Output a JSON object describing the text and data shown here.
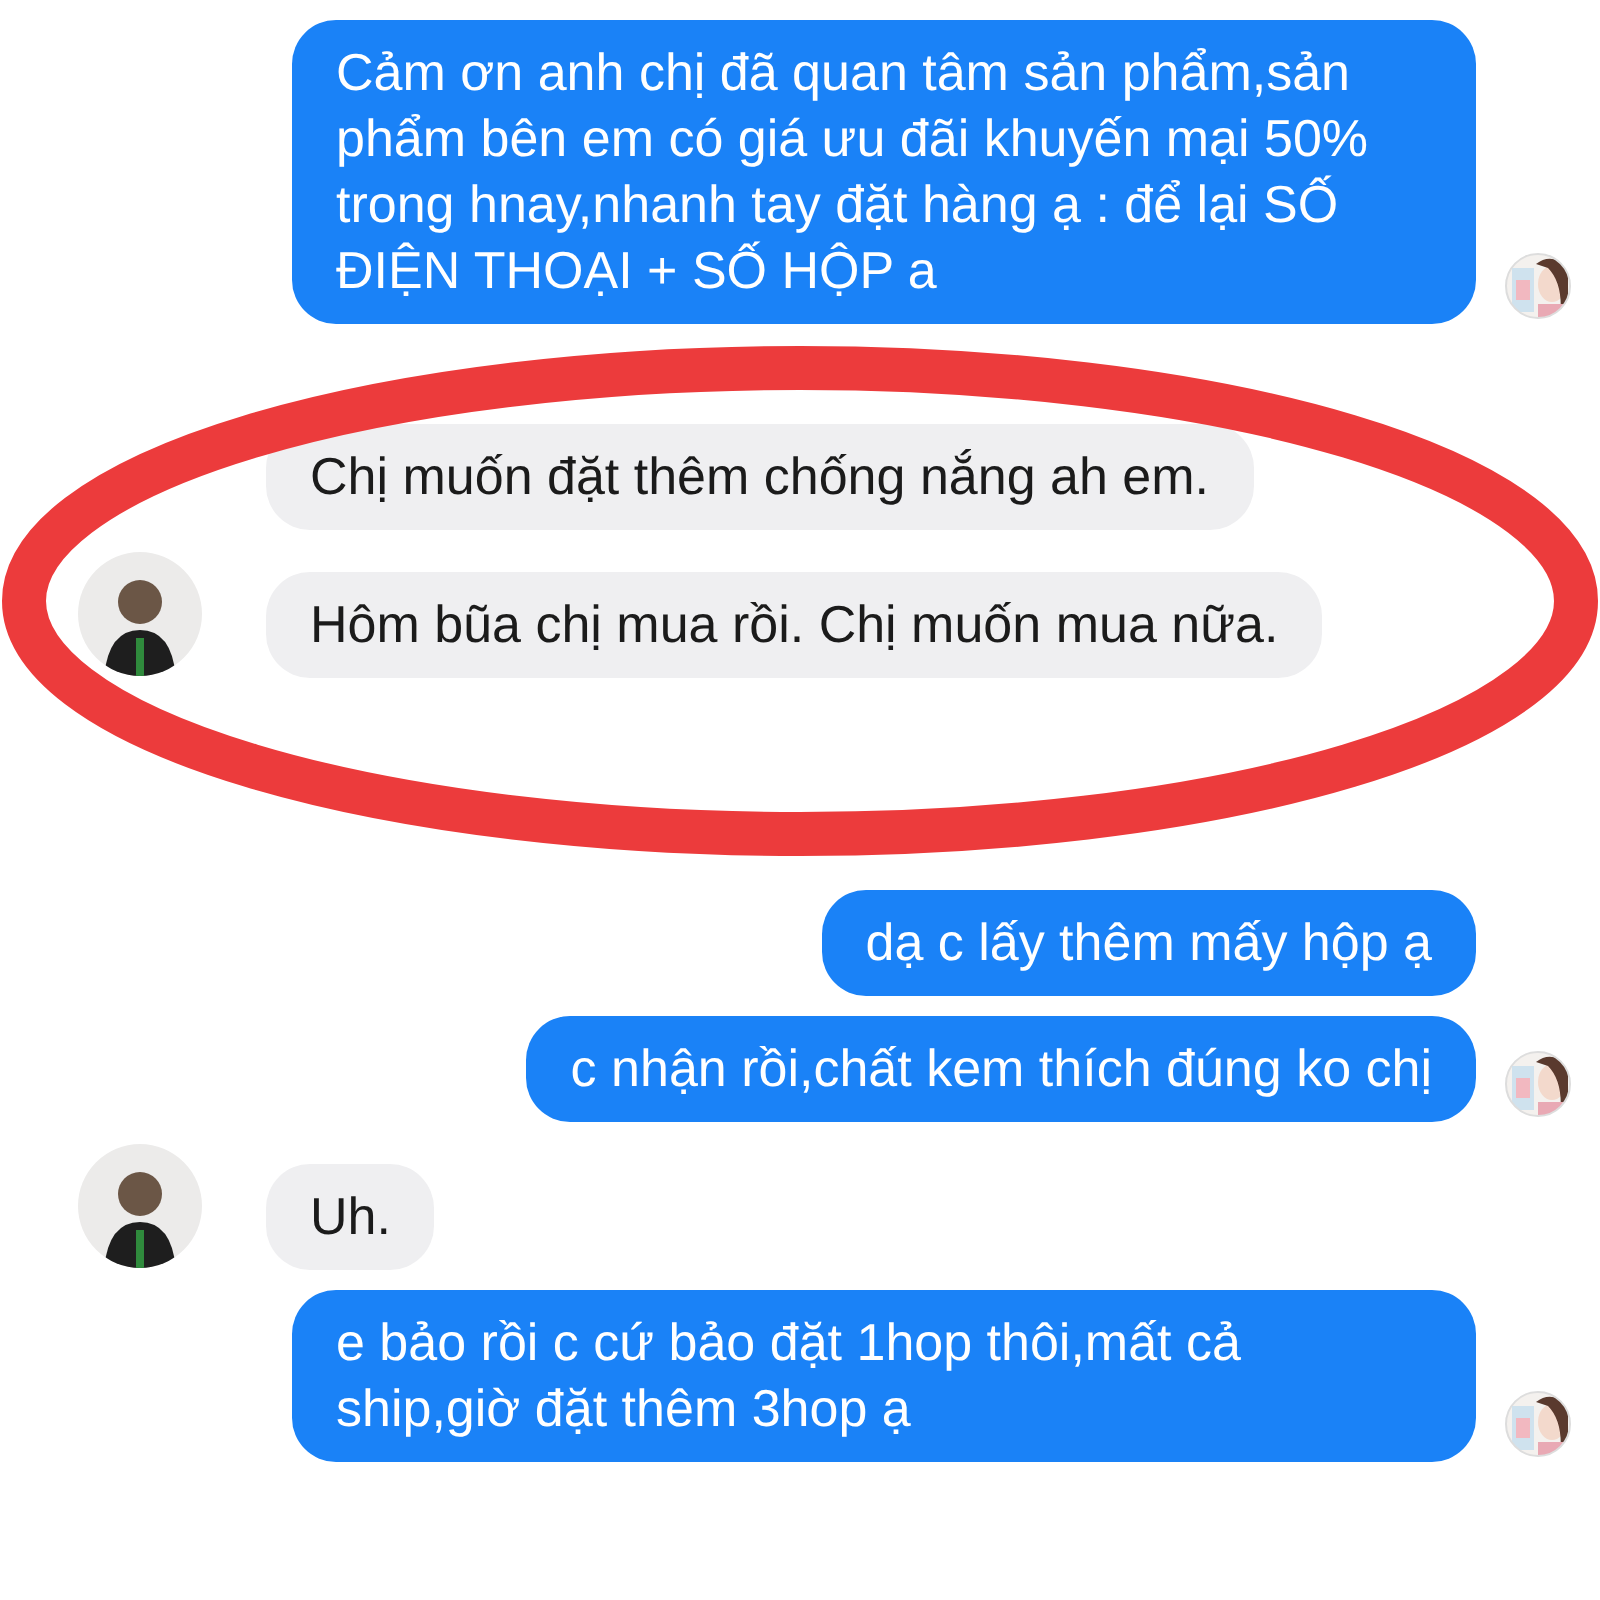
{
  "messages": [
    {
      "kind": "outgoing",
      "text": "Cảm ơn anh chị đã quan tâm sản phẩm,sản phẩm  bên em có giá ưu đãi khuyến mại 50% trong hnay,nhanh tay đặt hàng ạ : để lại SỐ ĐIỆN THOẠI + SỐ HỘP a",
      "avatar": true,
      "circled": false
    },
    {
      "kind": "incoming",
      "text": "Chị muốn đặt thêm chống nắng ah em.",
      "avatar": false,
      "circled": true
    },
    {
      "kind": "incoming",
      "text": "Hôm bũa chị mua rồi. Chị muốn mua nữa.",
      "avatar": true,
      "circled": true
    },
    {
      "kind": "outgoing",
      "text": "dạ c lấy thêm mấy hộp ạ",
      "avatar": false,
      "circled": false
    },
    {
      "kind": "outgoing",
      "text": "c nhận rồi,chất kem thích đúng ko chị",
      "avatar": true,
      "circled": false
    },
    {
      "kind": "incoming",
      "text": "Uh.",
      "avatar": true,
      "circled": false
    },
    {
      "kind": "outgoing",
      "text": "e bảo rồi c cứ bảo đặt 1hop thôi,mất cả ship,giờ đặt thêm 3hop ạ",
      "avatar": true,
      "circled": false
    }
  ]
}
